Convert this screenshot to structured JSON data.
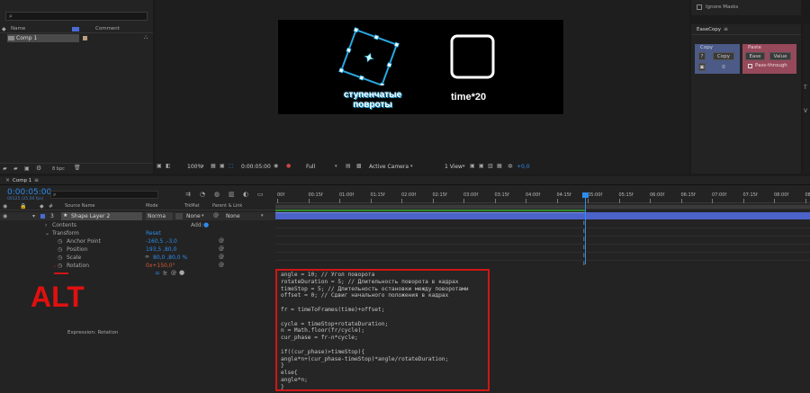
{
  "project": {
    "search_placeholder": "",
    "col_name": "Name",
    "col_comment": "Comment",
    "item_name": "Comp 1",
    "bpc": "8 bpc"
  },
  "effects": {
    "ignore_masks": "Ignore Masks",
    "panel_title": "EaseCopy",
    "copy_label": "Copy",
    "copy_btn": "Copy",
    "copy_q": "?",
    "copy_value": "0",
    "paste_label": "Paste",
    "ease_btn": "Ease",
    "value_btn": "Value",
    "passthrough": "Pass-through"
  },
  "viewer": {
    "left_text_line1": "ступенчатые",
    "left_text_line2": "повроты",
    "right_text": "time*20",
    "zoom": "100%",
    "timecode": "0:00:05:00",
    "resolution": "Full",
    "camera": "Active Camera",
    "view": "1 View",
    "exposure": "+0,0"
  },
  "timeline": {
    "tab": "Comp 1",
    "current_time": "0:00:05:00",
    "frames": "00125 (25.00 fps)",
    "col_source": "Source Name",
    "col_mode": "Mode",
    "col_trkmat": "TrkMat",
    "col_parent": "Parent & Link",
    "layer_num": "3",
    "layer_name": "Shape Layer 2",
    "layer_mode": "Norma",
    "layer_trkmat": "None",
    "layer_parent": "None",
    "contents": "Contents",
    "add": "Add:",
    "transform": "Transform",
    "reset": "Reset",
    "anchor_label": "Anchor Point",
    "anchor_value": "-160,5 ,-3,0",
    "position_label": "Position",
    "position_value": "193,5 ,80,0",
    "scale_label": "Scale",
    "scale_value": "80,0 ,80,0 %",
    "rotation_label": "Rotation",
    "rotation_value": "0x+150,0°",
    "expression_label": "Expression: Rotation",
    "alt_label": "ALT",
    "ruler": [
      "00f",
      "00:15f",
      "01:00f",
      "01:15f",
      "02:00f",
      "02:15f",
      "03:00f",
      "03:15f",
      "04:00f",
      "04:15f",
      "05:00f",
      "05:15f",
      "06:00f",
      "06:15f",
      "07:00f",
      "07:15f",
      "08:00f",
      "08:15"
    ]
  },
  "code": [
    "angle = 10; // Угол поворота",
    "rotateDuration = 5; // Длительность поворота в кадрах",
    "timeStop = 5; // Длительность остановки между поворотами",
    "offset = 0; // Сдвиг начального положения в кадрах",
    "",
    "fr = timeToFrames(time)+offset;",
    "",
    "cycle = timeStop+rotateDuration;",
    "n = Math.floor(fr/cycle);",
    "cur_phase = fr-n*cycle;",
    "",
    "if((cur_phase)>timeStop){",
    "angle*n+(cur_phase-timeStop)*angle/rotateDuration;",
    "}",
    "else{",
    "angle*n;",
    "}"
  ],
  "colors": {
    "accent": "#2d8ceb",
    "highlight": "#d01616",
    "label_blue": "#4a6bd6"
  }
}
